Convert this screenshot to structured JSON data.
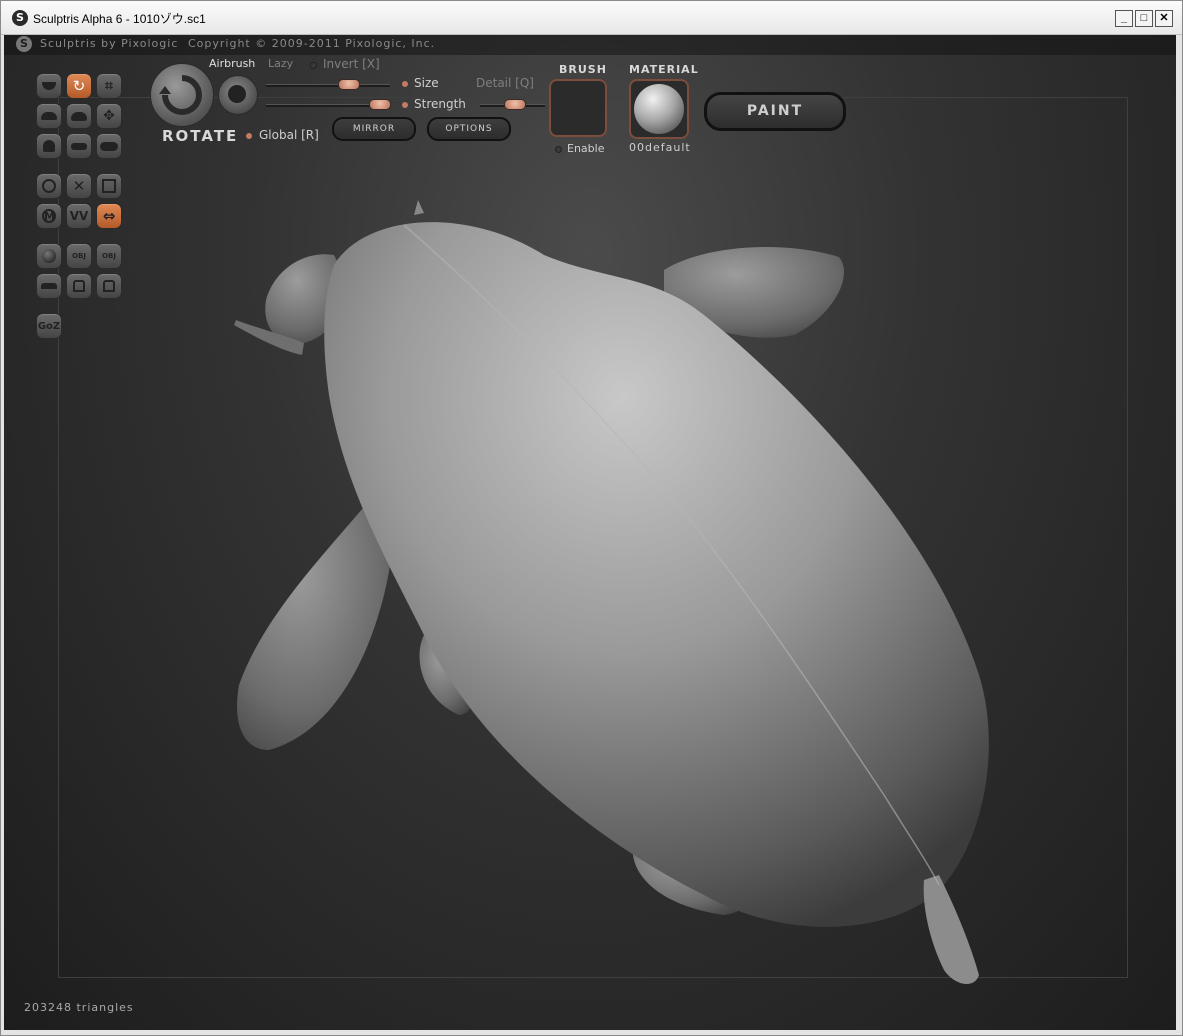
{
  "window": {
    "title": "Sculptris Alpha 6 - 1010ゾウ.sc1",
    "minimize": "_",
    "maximize": "□",
    "close": "✕"
  },
  "header": {
    "app_name": "Sculptris by Pixologic",
    "copyright": "Copyright © 2009-2011 Pixologic, Inc."
  },
  "toolbar": {
    "tool_name": "ROTATE",
    "airbrush": "Airbrush",
    "lazy": "Lazy",
    "invert": "Invert [X]",
    "size": "Size",
    "strength": "Strength",
    "detail": "Detail [Q]",
    "global": "Global [R]",
    "mirror": "MIRROR",
    "options": "OPTIONS",
    "brush_header": "BRUSH",
    "brush_enable": "Enable",
    "material_header": "MATERIAL",
    "material_name": "00default",
    "paint": "PAINT"
  },
  "tools": {
    "goz": "GoZ",
    "obj_import": "OBJ",
    "obj_export": "OBJ"
  },
  "status": {
    "triangles": "203248 triangles"
  },
  "colors": {
    "accent": "#c57b62",
    "active_tool": "#d07a45"
  }
}
